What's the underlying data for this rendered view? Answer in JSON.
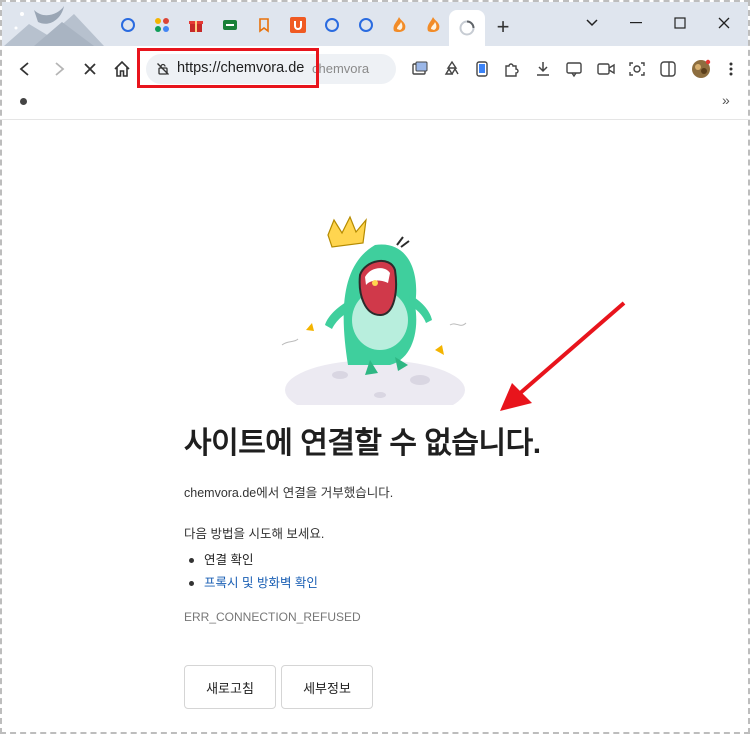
{
  "browser": {
    "address": {
      "url": "https://chemvora.de",
      "ghost_text": "chemvora"
    },
    "new_tab_label": "+",
    "tab_favicons": [
      "circle-blue-icon",
      "apps-grid-icon",
      "gift-icon",
      "green-sheet-icon",
      "bookmark-tag-icon",
      "u-orange-icon",
      "circle-blue-icon",
      "circle-blue-icon",
      "orange-flame-icon",
      "orange-flame-icon",
      "loading-spinner-icon"
    ],
    "bookmarks_more": "»"
  },
  "error": {
    "title": "사이트에 연결할 수 없습니다.",
    "description": "chemvora.de에서 연결을 거부했습니다.",
    "try_heading": "다음 방법을 시도해 보세요.",
    "suggestions": [
      {
        "label": "연결 확인"
      },
      {
        "label": "프록시 및 방화벽 확인"
      }
    ],
    "code": "ERR_CONNECTION_REFUSED",
    "reload_label": "새로고침",
    "details_label": "세부정보"
  },
  "colors": {
    "tabstrip": "#dfe5ee",
    "highlight": "#e8141c",
    "link": "#1a5fb4",
    "dino": "#3fcf9d"
  }
}
